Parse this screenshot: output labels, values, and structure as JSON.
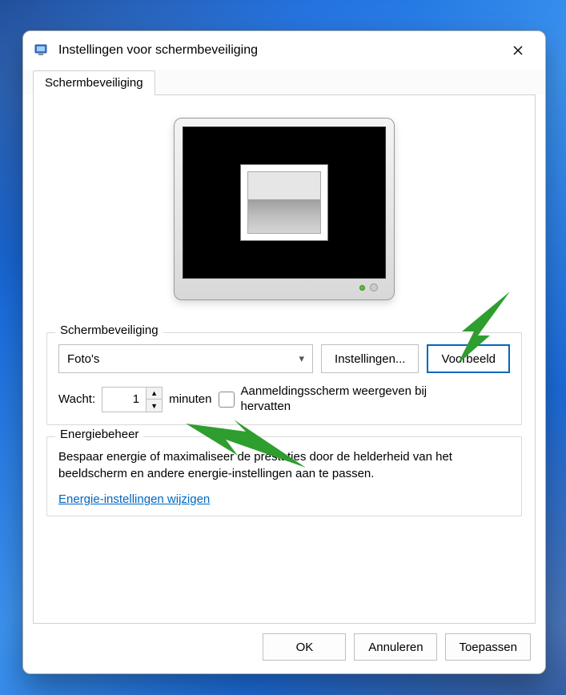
{
  "window": {
    "title": "Instellingen voor schermbeveiliging"
  },
  "tabs": {
    "active": "Schermbeveiliging"
  },
  "screensaver_group": {
    "title": "Schermbeveiliging",
    "selected": "Foto's",
    "settings_button": "Instellingen...",
    "preview_button": "Voorbeeld",
    "wait_label": "Wacht:",
    "wait_value": "1",
    "wait_unit": "minuten",
    "resume_checkbox_label": "Aanmeldingsscherm weergeven bij hervatten",
    "resume_checked": false
  },
  "power_group": {
    "title": "Energiebeheer",
    "description": "Bespaar energie of maximaliseer de prestaties door de helderheid van het beeldscherm en andere energie-instellingen aan te passen.",
    "link_text": "Energie-instellingen wijzigen"
  },
  "footer": {
    "ok": "OK",
    "cancel": "Annuleren",
    "apply": "Toepassen"
  },
  "annotations": {
    "arrow_color": "#2e9e2e"
  }
}
